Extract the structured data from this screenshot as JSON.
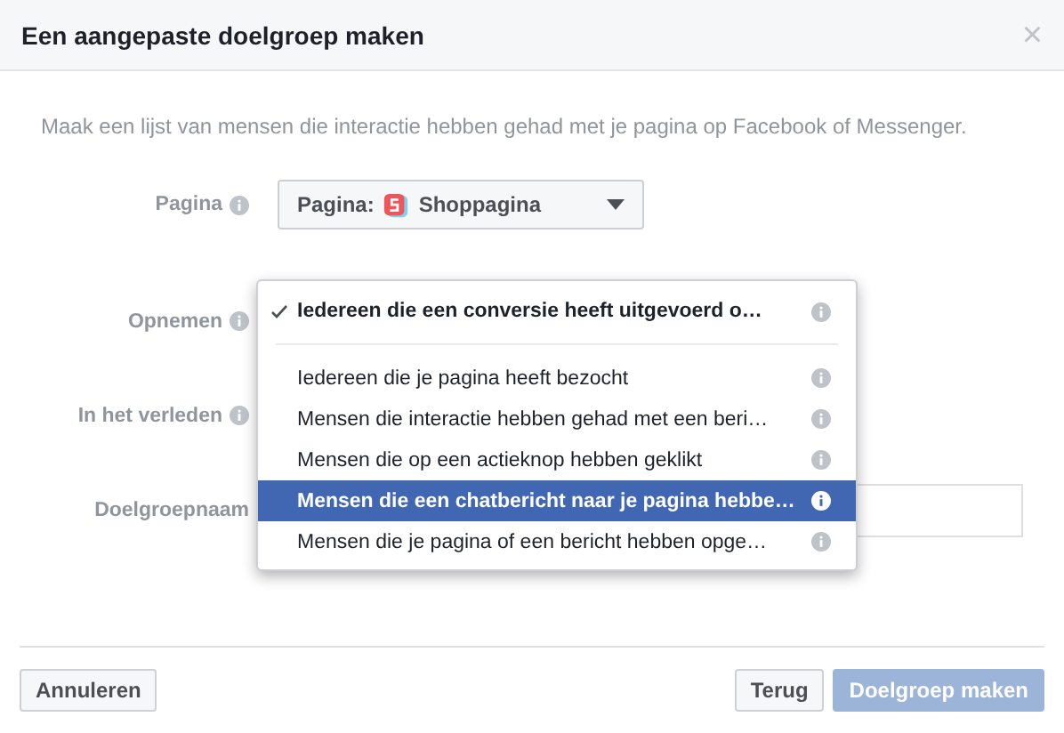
{
  "dialog": {
    "title": "Een aangepaste doelgroep maken",
    "close": "×"
  },
  "description": "Maak een lijst van mensen die interactie hebben gehad met je pagina op Facebook of Messenger.",
  "fields": [
    {
      "label": "Pagina",
      "kind": "page-select",
      "prefix": "Pagina:",
      "value": "Shoppagina"
    },
    {
      "label": "Opnemen",
      "kind": "hidden"
    },
    {
      "label": "In het verleden",
      "kind": "hidden"
    },
    {
      "label": "Doelgroepnaam",
      "kind": "text"
    }
  ],
  "menu": {
    "items": [
      {
        "label": "Iedereen die een conversie heeft uitgevoerd o…",
        "checked": true,
        "selected": false
      },
      {
        "label": "Iedereen die je pagina heeft bezocht",
        "checked": false,
        "selected": false
      },
      {
        "label": "Mensen die interactie hebben gehad met een beri…",
        "checked": false,
        "selected": false
      },
      {
        "label": "Mensen die op een actieknop hebben geklikt",
        "checked": false,
        "selected": false
      },
      {
        "label": "Mensen die een chatbericht naar je pagina hebbe…",
        "checked": false,
        "selected": true
      },
      {
        "label": "Mensen die je pagina of een bericht hebben opge…",
        "checked": false,
        "selected": false
      }
    ]
  },
  "buttons": [
    {
      "label": "Annuleren",
      "kind": "default",
      "disabled": false
    },
    {
      "label": "Terug",
      "kind": "default",
      "disabled": false
    },
    {
      "label": "Doelgroep maken",
      "kind": "primary",
      "disabled": true
    }
  ]
}
